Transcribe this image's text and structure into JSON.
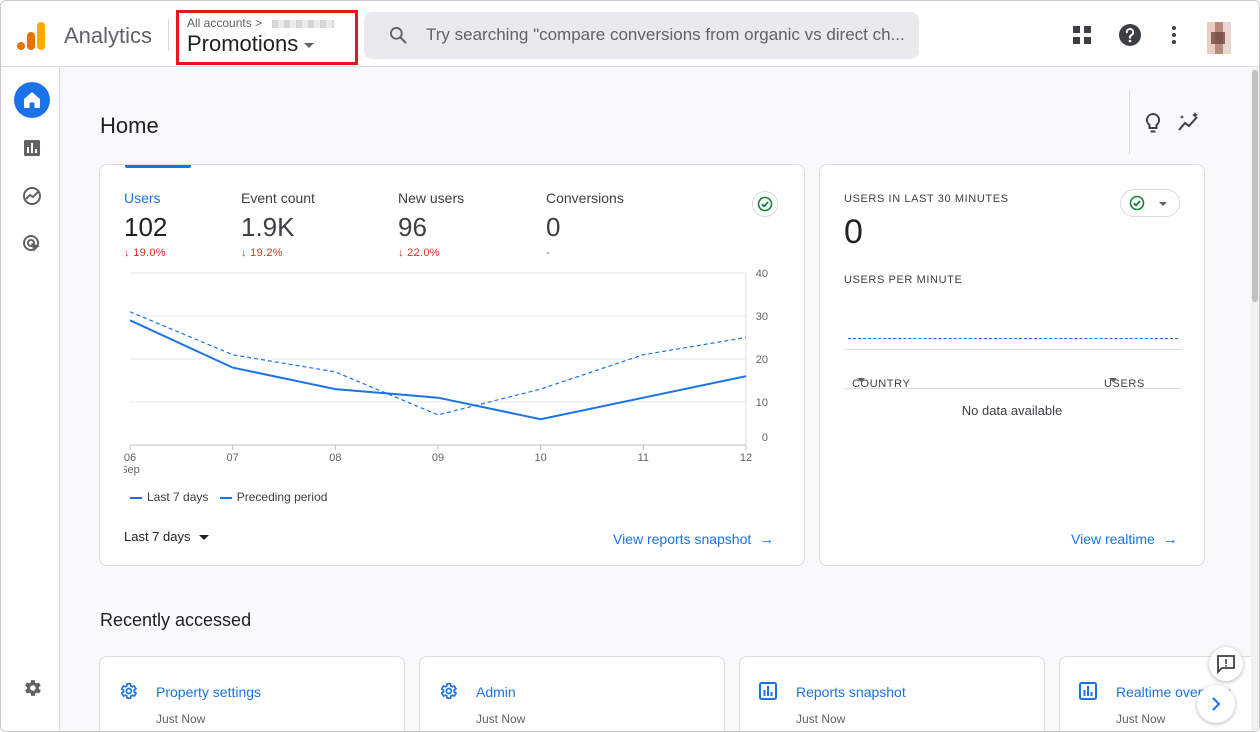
{
  "app": {
    "name": "Analytics",
    "breadcrumb": "All accounts",
    "property": "Promotions",
    "search_placeholder": "Try searching \"compare conversions from organic vs direct ch...",
    "accent_color": "#1a73e8",
    "highlight_color": "#e8161b",
    "icons": [
      "analytics-logo-icon",
      "search-icon",
      "apps-grid-icon",
      "help-icon",
      "more-vert-icon"
    ]
  },
  "nav": {
    "items": [
      {
        "name": "home",
        "icon": "home-icon",
        "active": true
      },
      {
        "name": "reports",
        "icon": "bar-chart-icon",
        "active": false
      },
      {
        "name": "explore",
        "icon": "explore-icon",
        "active": false
      },
      {
        "name": "advertising",
        "icon": "target-cursor-icon",
        "active": false
      }
    ],
    "settings_icon": "gear-icon"
  },
  "home": {
    "title": "Home",
    "header_icons": [
      "lightbulb-icon",
      "insights-sparkle-icon"
    ],
    "metrics": [
      {
        "label": "Users",
        "value": "102",
        "change": "19.0%",
        "direction": "down",
        "active": true
      },
      {
        "label": "Event count",
        "value": "1.9K",
        "change": "19.2%",
        "direction": "down",
        "active": false
      },
      {
        "label": "New users",
        "value": "96",
        "change": "22.0%",
        "direction": "down",
        "active": false
      },
      {
        "label": "Conversions",
        "value": "0",
        "change": "-",
        "direction": "none",
        "active": false
      }
    ],
    "date_range": "Last 7 days",
    "view_snapshot_link": "View reports snapshot",
    "arrow": "→"
  },
  "chart_data": {
    "type": "line",
    "x": [
      "06",
      "07",
      "08",
      "09",
      "10",
      "11",
      "12"
    ],
    "x_sublabel": "Sep",
    "series": [
      {
        "name": "Last 7 days",
        "style": "solid",
        "values": [
          29,
          18,
          13,
          11,
          6,
          11,
          16
        ]
      },
      {
        "name": "Preceding period",
        "style": "dashed",
        "values": [
          31,
          21,
          17,
          7,
          13,
          21,
          25
        ]
      }
    ],
    "yticks": [
      0,
      10,
      20,
      30,
      40
    ],
    "ylim": [
      0,
      40
    ],
    "grid": true,
    "y_axis_position": "right",
    "legend_position": "bottom-left",
    "color": "#1a73e8"
  },
  "realtime": {
    "title": "USERS IN LAST 30 MINUTES",
    "value": "0",
    "subtitle": "USERS PER MINUTE",
    "col_country": "COUNTRY",
    "col_users": "USERS",
    "empty": "No data available",
    "link": "View realtime"
  },
  "recent": {
    "title": "Recently accessed",
    "items": [
      {
        "name": "Property settings",
        "time": "Just Now",
        "icon": "gear-icon"
      },
      {
        "name": "Admin",
        "time": "Just Now",
        "icon": "gear-icon"
      },
      {
        "name": "Reports snapshot",
        "time": "Just Now",
        "icon": "bar-chart-icon"
      },
      {
        "name": "Realtime overview",
        "time": "Just Now",
        "icon": "bar-chart-icon"
      }
    ]
  }
}
